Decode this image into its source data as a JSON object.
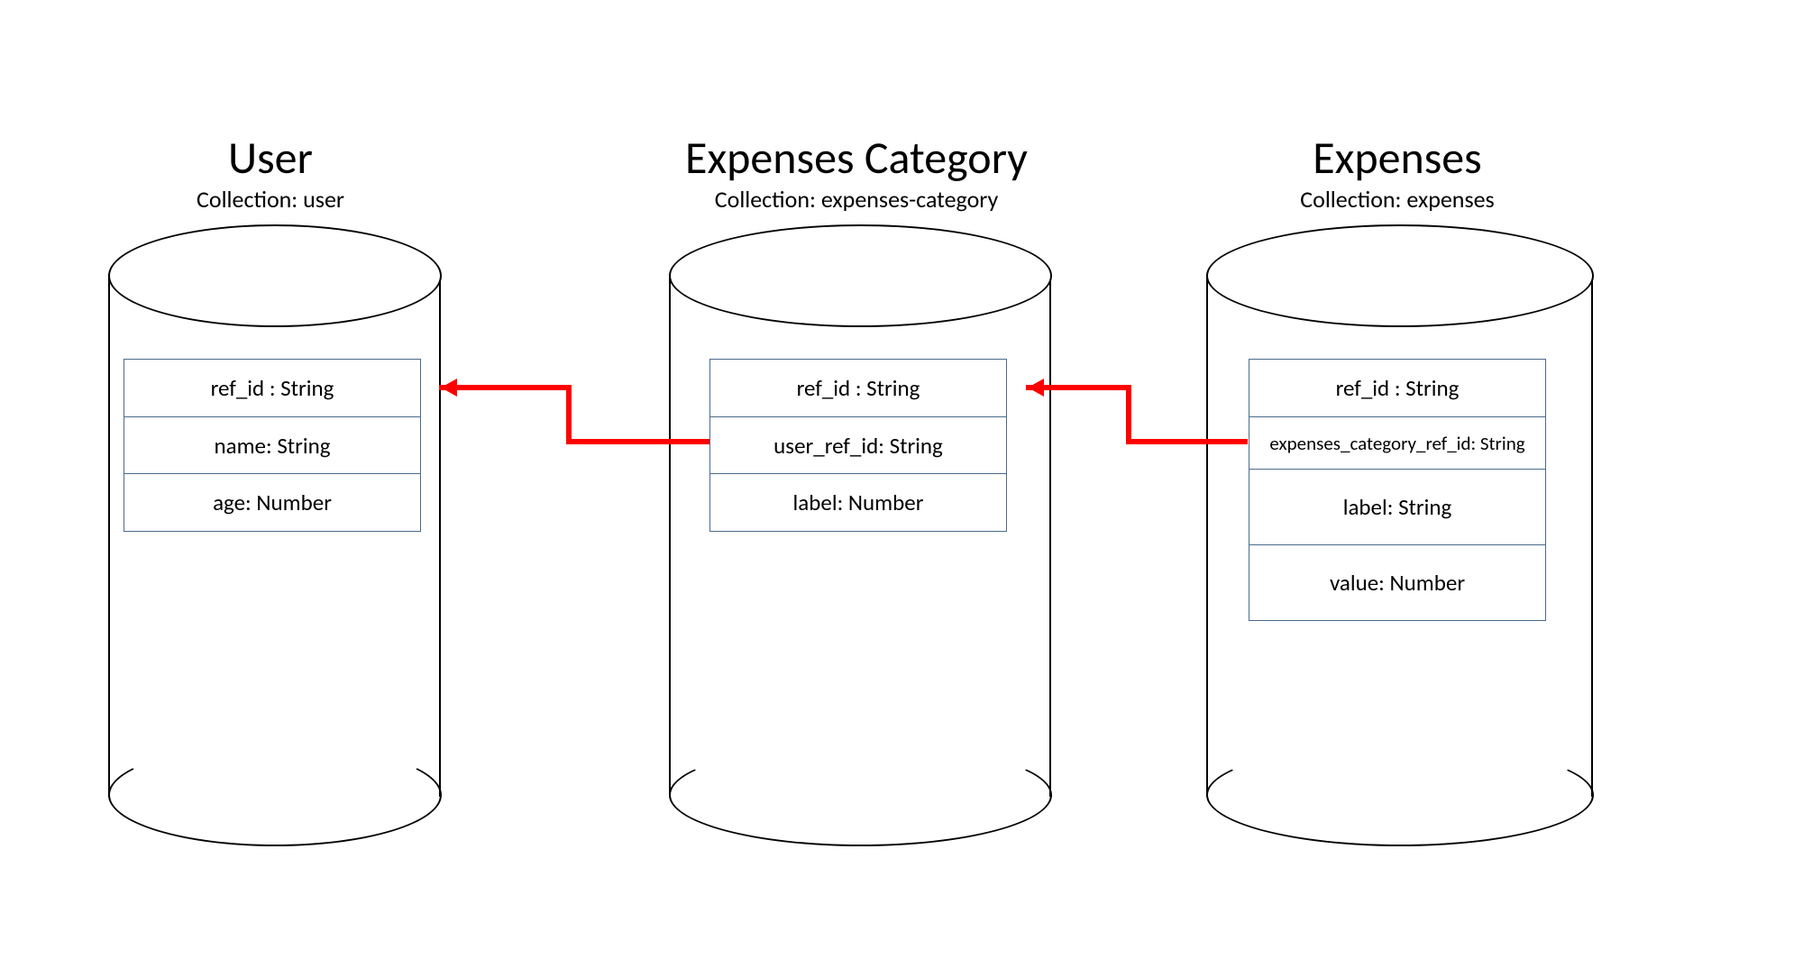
{
  "collections": [
    {
      "title": "User",
      "subtitle": "Collection: user",
      "fields": [
        {
          "label": "ref_id : String"
        },
        {
          "label": "name: String"
        },
        {
          "label": "age: Number"
        }
      ]
    },
    {
      "title": "Expenses Category",
      "subtitle": "Collection: expenses-category",
      "fields": [
        {
          "label": "ref_id : String"
        },
        {
          "label": "user_ref_id: String"
        },
        {
          "label": "label: Number"
        }
      ]
    },
    {
      "title": "Expenses",
      "subtitle": "Collection: expenses",
      "fields": [
        {
          "label": "ref_id : String"
        },
        {
          "label": "expenses_category_ref_id: String"
        },
        {
          "label": "label: String"
        },
        {
          "label": "value: Number"
        }
      ]
    }
  ],
  "arrow_color": "#ff0000"
}
